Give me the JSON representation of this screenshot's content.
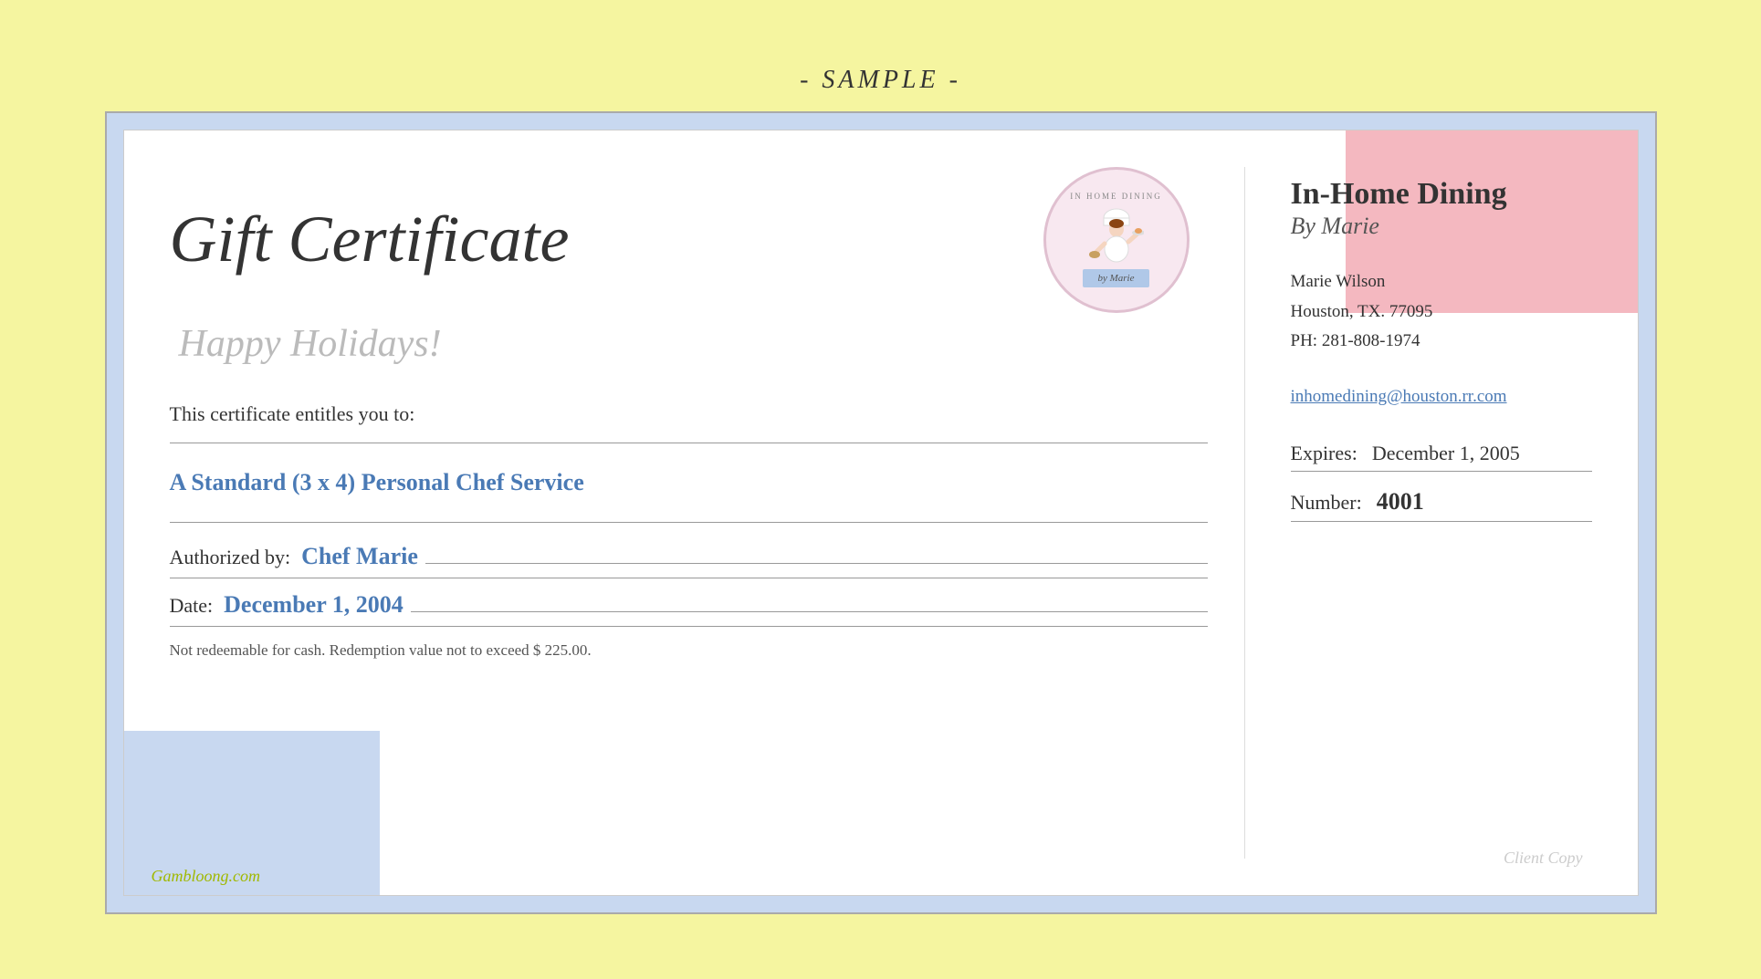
{
  "page": {
    "background_color": "#f5f5a0",
    "sample_label": "- SAMPLE -"
  },
  "certificate": {
    "title": "Gift Certificate",
    "subtitle": "Happy Holidays!",
    "entitles_text": "This certificate entitles you to:",
    "service_name": "A Standard (3 x 4) Personal Chef Service",
    "authorized_label": "Authorized by:",
    "authorized_value": "Chef Marie",
    "date_label": "Date:",
    "date_value": "December 1, 2004",
    "disclaimer": "Not redeemable for cash. Redemption value not to exceed $ 225.00.",
    "company_name": "In-Home Dining",
    "company_subtitle": "By Marie",
    "contact": {
      "name": "Marie Wilson",
      "address": "Houston, TX.  77095",
      "phone": "PH: 281-808-1974"
    },
    "email": "inhomedining@houston.rr.com",
    "expires_label": "Expires:",
    "expires_value": "December 1, 2005",
    "number_label": "Number:",
    "number_value": "4001",
    "client_copy_watermark": "Client Copy",
    "watermark_site": "Gambloong.com",
    "logo": {
      "text_top_line1": "IN HOME DINING",
      "text_top_line2": "",
      "ribbon_text": "by Marie"
    }
  }
}
